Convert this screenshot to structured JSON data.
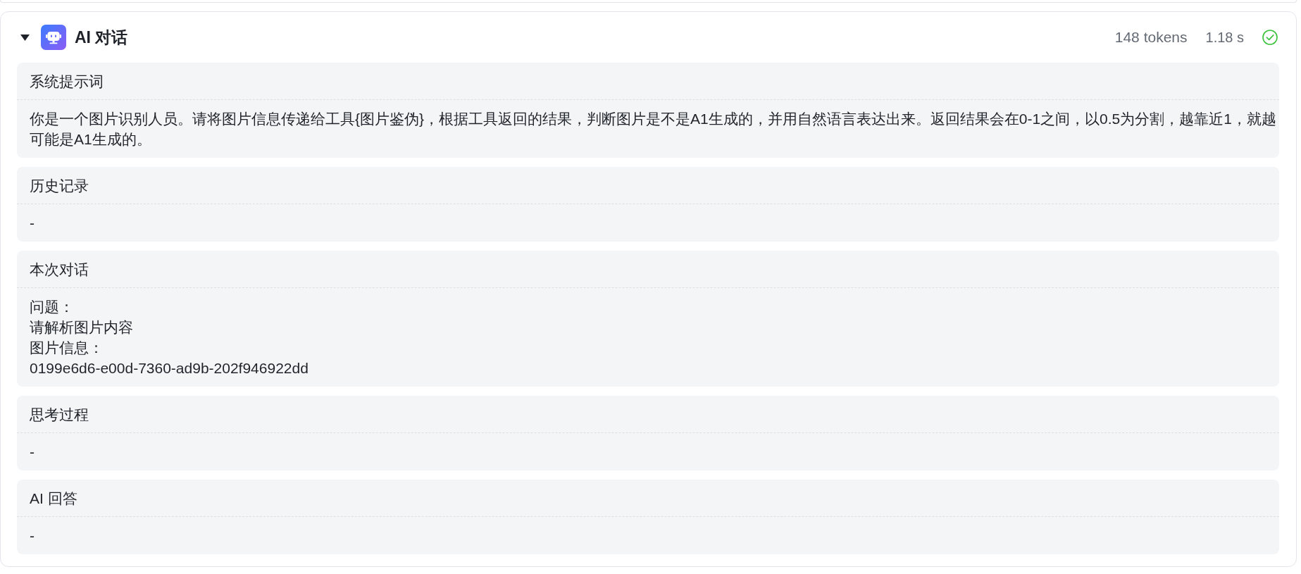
{
  "node": {
    "title": "AI 对话",
    "expanded": true,
    "tokens": "148 tokens",
    "duration": "1.18 s",
    "completed": true
  },
  "sections": [
    {
      "title": "系统提示词",
      "lines": [
        "你是一个图片识别人员。请将图片信息传递给工具{图片鉴伪}，根据工具返回的结果，判断图片是不是A1生成的，并用自然语言表达出来。返回结果会在0-1之间，以0.5为分割，越靠近1，就越可能是A1生成的。"
      ]
    },
    {
      "title": "历史记录",
      "lines": [
        "-"
      ]
    },
    {
      "title": "本次对话",
      "lines": [
        "问题：",
        "请解析图片内容",
        "图片信息：",
        "0199e6d6-e00d-7360-ad9b-202f946922dd"
      ]
    },
    {
      "title": "思考过程",
      "lines": [
        "-"
      ]
    },
    {
      "title": "AI 回答",
      "lines": [
        "-"
      ]
    }
  ]
}
